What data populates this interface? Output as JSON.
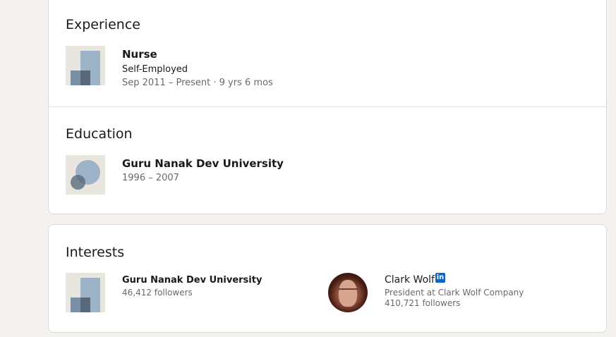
{
  "experience": {
    "heading": "Experience",
    "items": [
      {
        "title": "Nurse",
        "company": "Self-Employed",
        "dates": "Sep 2011 – Present · 9 yrs 6 mos"
      }
    ]
  },
  "education": {
    "heading": "Education",
    "items": [
      {
        "school": "Guru Nanak Dev University",
        "years": "1996 – 2007"
      }
    ]
  },
  "interests": {
    "heading": "Interests",
    "items": [
      {
        "name": "Guru Nanak Dev University",
        "followers": "46,412 followers"
      },
      {
        "name": "Clark Wolf",
        "headline": "President at Clark Wolf Company",
        "followers": "410,721 followers",
        "badge": "in"
      }
    ]
  },
  "colors": {
    "brand_blue": "#0a66c2",
    "page_background": "#f3f2ef",
    "card_background": "#ffffff"
  },
  "icons": [
    "company-logo-placeholder-icon",
    "school-logo-placeholder-icon",
    "linkedin-influencer-icon"
  ]
}
